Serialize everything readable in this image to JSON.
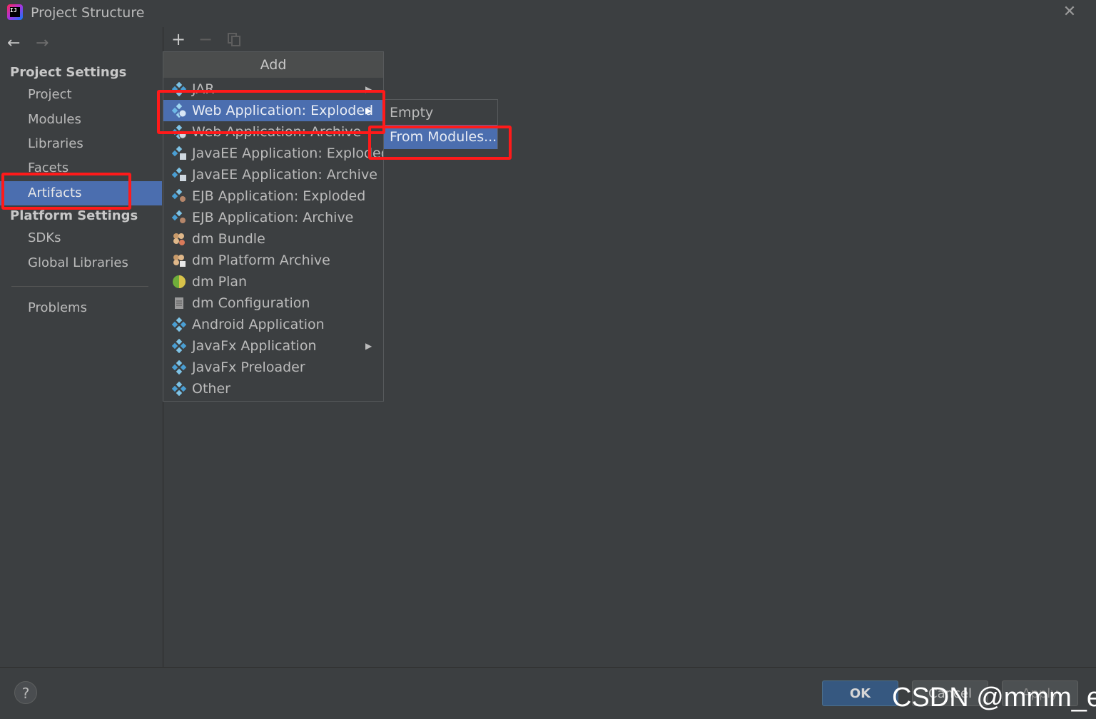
{
  "window": {
    "title": "Project Structure"
  },
  "sidebar": {
    "project_settings_header": "Project Settings",
    "project_items": [
      "Project",
      "Modules",
      "Libraries",
      "Facets",
      "Artifacts"
    ],
    "platform_settings_header": "Platform Settings",
    "platform_items": [
      "SDKs",
      "Global Libraries"
    ],
    "problems": "Problems",
    "selected": "Artifacts"
  },
  "add_menu": {
    "title": "Add",
    "items": [
      "JAR",
      "Web Application: Exploded",
      "Web Application: Archive",
      "JavaEE Application: Exploded",
      "JavaEE Application: Archive",
      "EJB Application: Exploded",
      "EJB Application: Archive",
      "dm Bundle",
      "dm Platform Archive",
      "dm Plan",
      "dm Configuration",
      "Android Application",
      "JavaFx Application",
      "JavaFx Preloader",
      "Other"
    ],
    "highlighted": "Web Application: Exploded"
  },
  "submenu": {
    "items": [
      "Empty",
      "From Modules..."
    ],
    "highlighted": "From Modules..."
  },
  "footer": {
    "help": "?",
    "ok": "OK",
    "cancel": "Cancel",
    "apply": "Apply"
  },
  "watermark": "CSDN @mmm_e",
  "colors": {
    "background": "#3c3f41",
    "selection": "#4b6eaf",
    "annotation": "#ff1a1a",
    "ok_button": "#365880"
  }
}
